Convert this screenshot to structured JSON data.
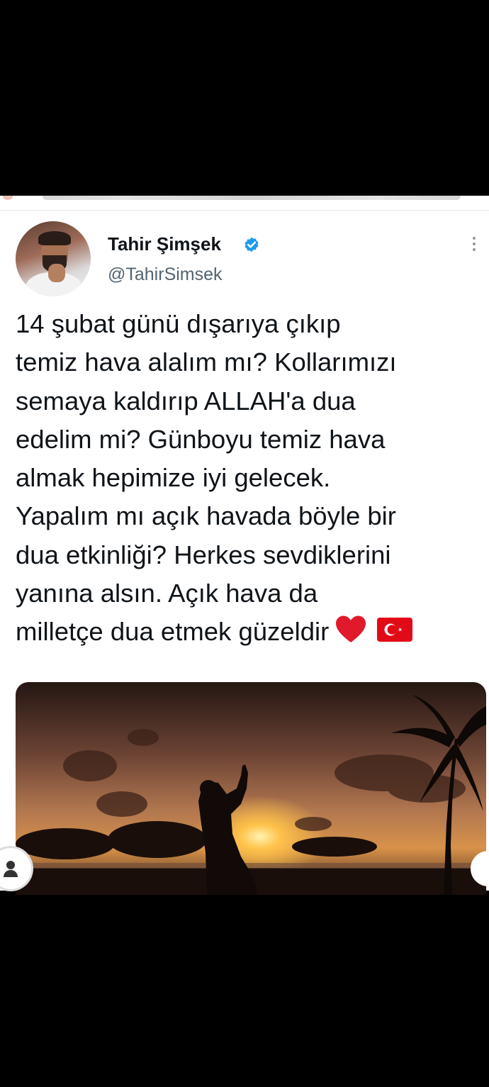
{
  "user": {
    "name": "Tahir Şimşek",
    "handle": "@TahirSimsek"
  },
  "tweet": {
    "lines": [
      "14 şubat günü dışarıya çıkıp",
      "temiz hava alalım mı? Kollarımızı",
      "semaya kaldırıp ALLAH'a dua",
      "edelim mi?  Günboyu temiz hava",
      "almak hepimize iyi gelecek.",
      "Yapalım mı açık havada böyle bir",
      "dua etkinliği? Herkes sevdiklerini",
      "yanına alsın. Açık hava da",
      "milletçe dua etmek güzeldir"
    ],
    "emojis": [
      "red-heart-icon",
      "turkey-flag-icon"
    ]
  },
  "icons": {
    "verified": "verified-badge-icon",
    "more": "more-options-icon",
    "left_button": "profile-icon"
  },
  "colors": {
    "verified": "#1d9bf0",
    "heart": "#e0192b",
    "flag": "#e30a17",
    "text": "#0f1419",
    "handle": "#536471"
  }
}
